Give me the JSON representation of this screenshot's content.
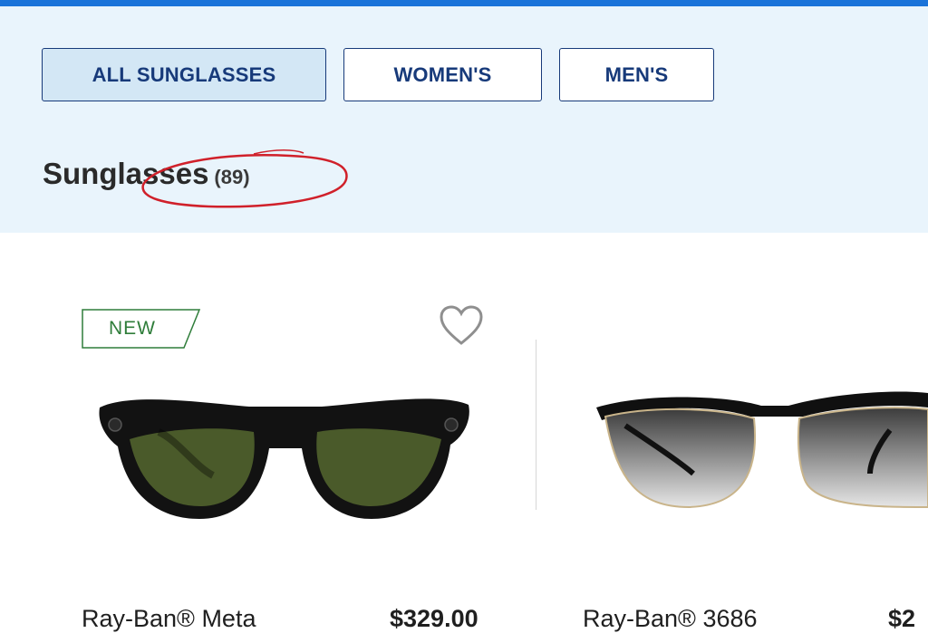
{
  "tabs": [
    {
      "label": "ALL SUNGLASSES",
      "active": true
    },
    {
      "label": "WOMEN'S",
      "active": false
    },
    {
      "label": "MEN'S",
      "active": false
    }
  ],
  "page": {
    "title": "Sunglasses",
    "count": "(89)"
  },
  "products": [
    {
      "badge": "NEW",
      "name": "Ray-Ban® Meta",
      "price": "$329.00"
    },
    {
      "name": "Ray-Ban® 3686",
      "price": "$2"
    }
  ],
  "colors": {
    "accent_bar": "#1a73d9",
    "header_bg": "#e9f4fc",
    "tab_text": "#173a7a",
    "badge_green": "#2f7d3a",
    "annotation_red": "#d0202a"
  },
  "icons": [
    "heart-icon"
  ]
}
